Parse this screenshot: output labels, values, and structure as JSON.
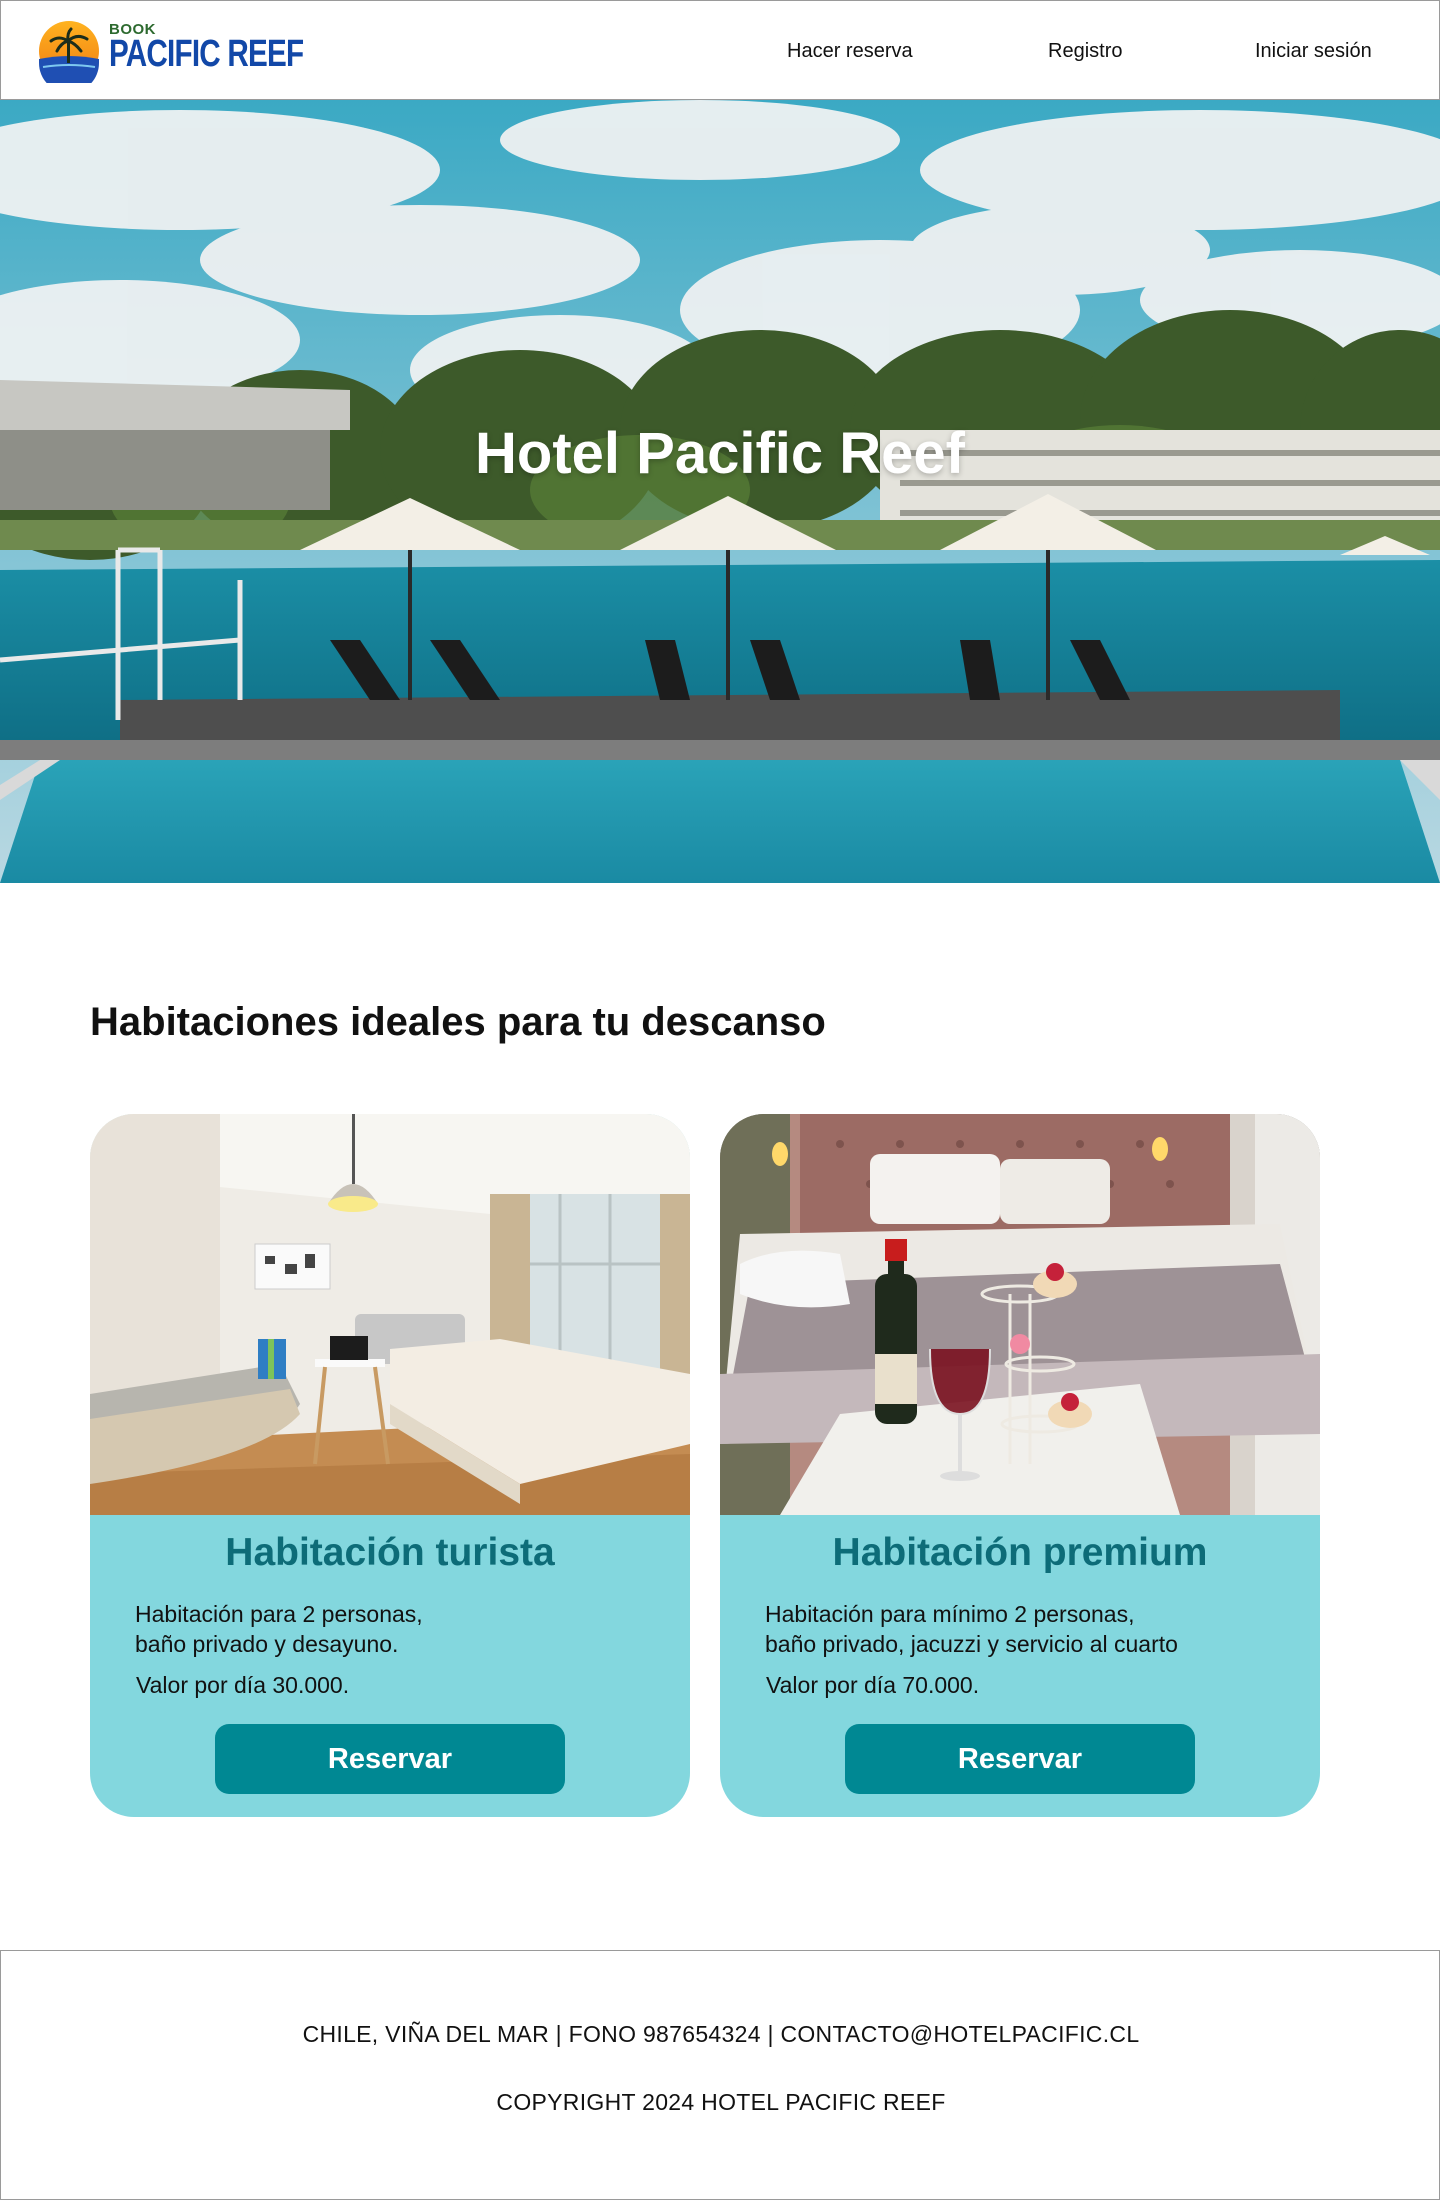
{
  "header": {
    "logo_top": "BOOK",
    "logo_name": "PACIFIC REEF",
    "nav": [
      "Hacer reserva",
      "Registro",
      "Iniciar sesión"
    ]
  },
  "hero": {
    "title": "Hotel Pacific Reef"
  },
  "rooms_section": {
    "heading": "Habitaciones ideales para tu descanso",
    "rooms": [
      {
        "title": "Habitación turista",
        "description": "Habitación para  2 personas,\nbaño privado y  desayuno.",
        "price": "Valor por día 30.000.",
        "button": "Reservar"
      },
      {
        "title": "Habitación premium",
        "description": "Habitación para mínimo 2 personas,\nbaño privado, jacuzzi y servicio al cuarto",
        "price": "Valor por día 70.000.",
        "button": "Reservar"
      }
    ]
  },
  "footer": {
    "contact": "CHILE, VIÑA DEL MAR | FONO 987654324 | CONTACTO@HOTELPACIFIC.CL",
    "copyright": "COPYRIGHT 2024 HOTEL PACIFIC REEF"
  },
  "colors": {
    "brand_blue": "#1248a8",
    "card_bg": "#83d7de",
    "card_title": "#0d6c78",
    "button_bg": "#008893"
  }
}
